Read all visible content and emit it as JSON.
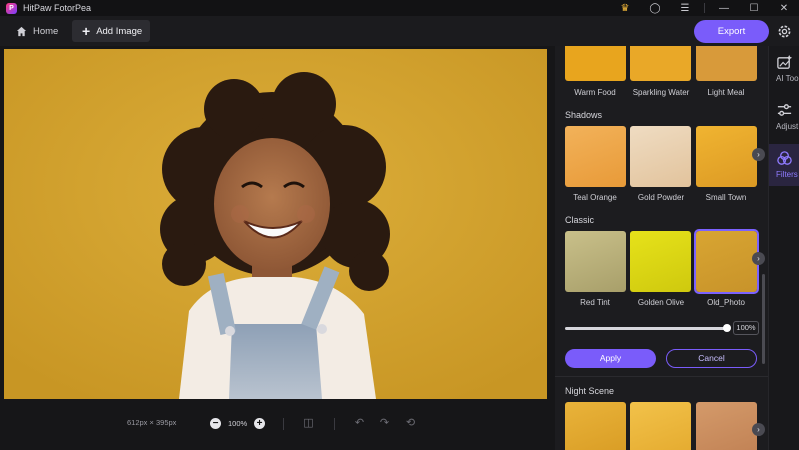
{
  "app": {
    "title": "HitPaw FotorPea",
    "logo_letter": "P"
  },
  "titlebar": {
    "icons": [
      "crown-icon",
      "account-icon",
      "menu-icon",
      "minimize-icon",
      "maximize-icon",
      "close-icon"
    ],
    "glyphs": {
      "crown": "♛",
      "account": "◯",
      "menu": "☰",
      "minimize": "—",
      "maximize": "☐",
      "close": "✕"
    }
  },
  "toolbar": {
    "home_label": "Home",
    "add_image_label": "Add Image",
    "export_label": "Export"
  },
  "canvas": {
    "image_dimensions": "612px × 395px",
    "zoom_level": "100%",
    "zoom_out_glyph": "−",
    "zoom_in_glyph": "+",
    "icons": [
      "compare-icon",
      "undo-icon",
      "redo-icon",
      "reset-icon"
    ],
    "glyphs": {
      "compare": "◫",
      "undo": "↶",
      "redo": "↷",
      "reset": "⟲"
    }
  },
  "filters": {
    "row_top": {
      "items": [
        "Warm Food",
        "Sparkling Water",
        "Light Meal"
      ]
    },
    "shadows": {
      "title": "Shadows",
      "items": [
        "Teal Orange",
        "Gold Powder",
        "Small Town"
      ]
    },
    "classic": {
      "title": "Classic",
      "items": [
        "Red Tint",
        "Golden Olive",
        "Old_Photo"
      ],
      "selected": "Old_Photo"
    },
    "night_scene": {
      "title": "Night Scene"
    },
    "arrow_glyph": "›",
    "intensity": {
      "value": "100%",
      "level": 1.0
    },
    "apply_label": "Apply",
    "cancel_label": "Cancel"
  },
  "rail": {
    "items": [
      {
        "label": "AI Tools",
        "icon": "ai-tools-icon"
      },
      {
        "label": "Adjust",
        "icon": "adjust-icon"
      },
      {
        "label": "Filters",
        "icon": "filters-icon",
        "active": true
      }
    ]
  },
  "colors": {
    "accent": "#7a5cfa",
    "background": "#141416",
    "panel": "#1c1c1f",
    "photo_bg": "#d4a42c"
  }
}
